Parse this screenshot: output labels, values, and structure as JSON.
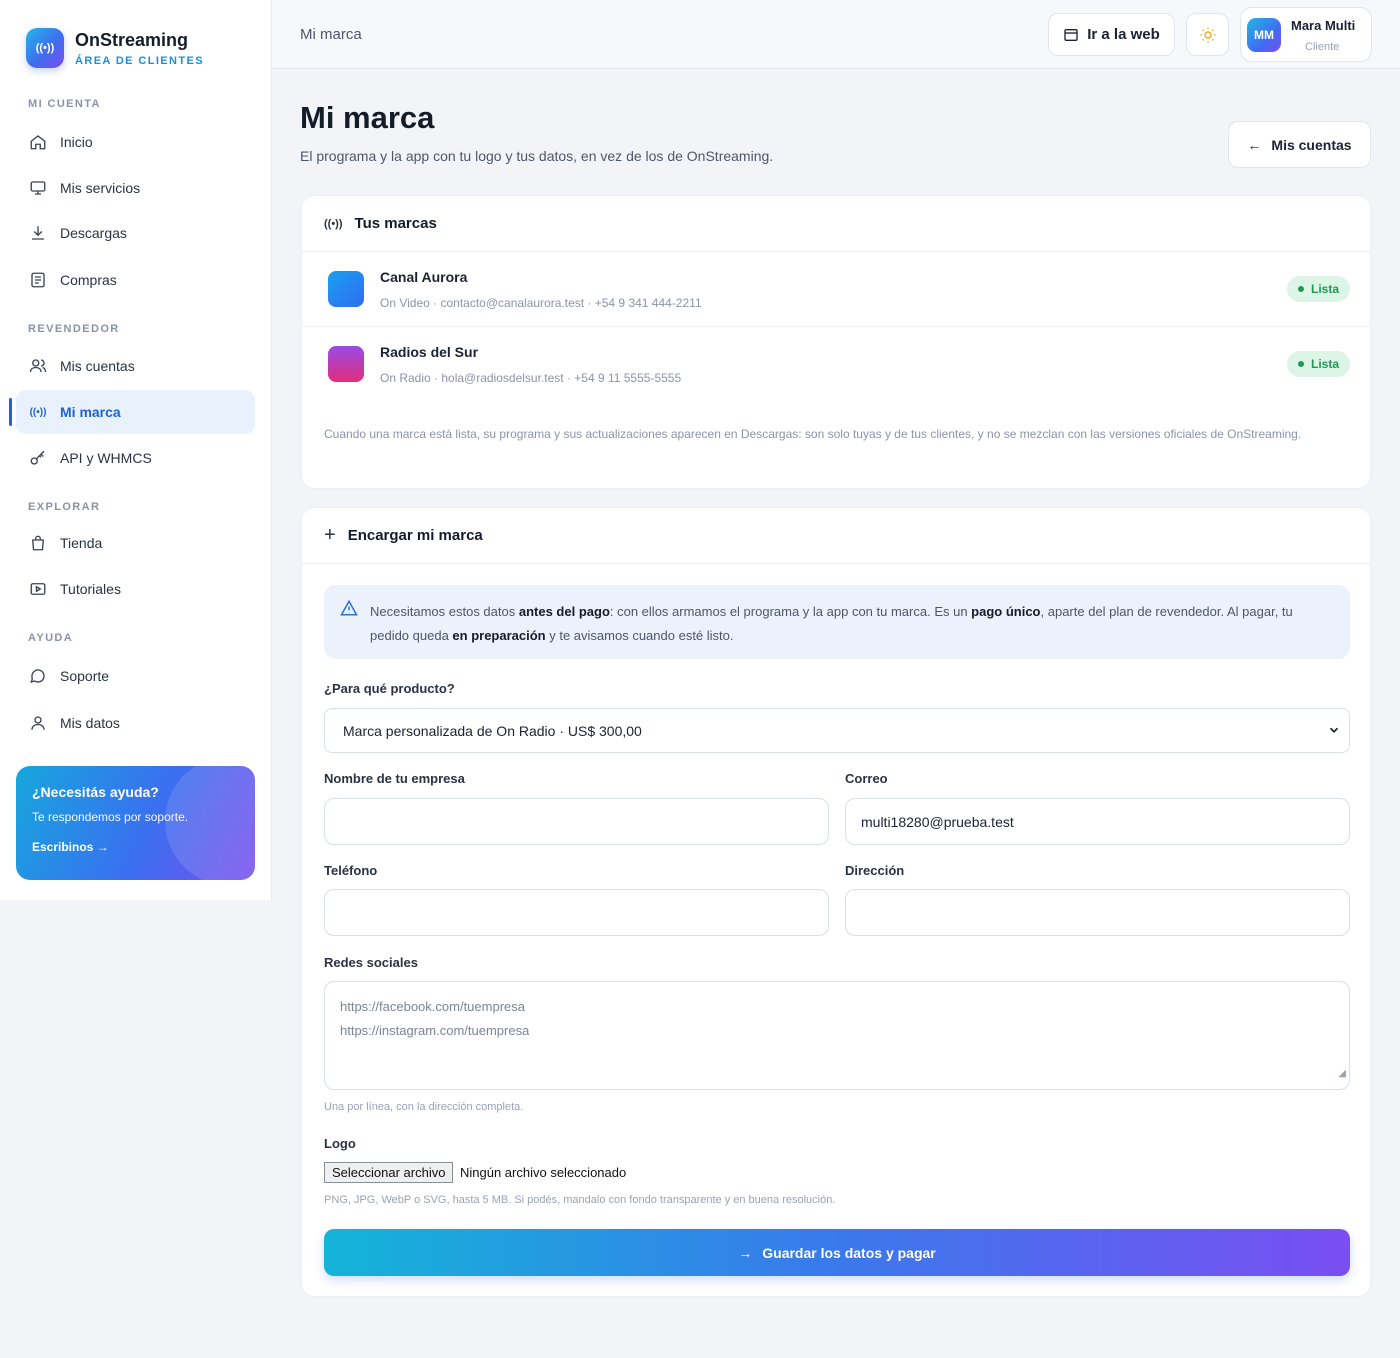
{
  "brand": {
    "name": "OnStreaming",
    "subtitle": "ÁREA DE CLIENTES",
    "logo_icon": "broadcast-icon"
  },
  "sidebar": {
    "sections": [
      {
        "title": "MI CUENTA"
      },
      {
        "title": "REVENDEDOR"
      },
      {
        "title": "EXPLORAR"
      },
      {
        "title": "AYUDA"
      }
    ],
    "items": [
      {
        "label": "Inicio",
        "icon": "home-icon"
      },
      {
        "label": "Mis servicios",
        "icon": "monitor-icon"
      },
      {
        "label": "Descargas",
        "icon": "download-icon"
      },
      {
        "label": "Compras",
        "icon": "receipt-icon"
      },
      {
        "label": "Mis cuentas",
        "icon": "users-icon"
      },
      {
        "label": "Mi marca",
        "icon": "broadcast-icon",
        "active": true
      },
      {
        "label": "API y WHMCS",
        "icon": "key-icon"
      },
      {
        "label": "Tienda",
        "icon": "shopping-bag-icon"
      },
      {
        "label": "Tutoriales",
        "icon": "play-icon"
      },
      {
        "label": "Soporte",
        "icon": "chat-icon"
      },
      {
        "label": "Mis datos",
        "icon": "user-icon"
      }
    ],
    "help": {
      "title": "¿Necesitás ayuda?",
      "text": "Te respondemos por soporte.",
      "link": "Escribinos →"
    }
  },
  "header": {
    "breadcrumb": "Mi marca",
    "web_button": "Ir a la web",
    "user": {
      "initials": "MM",
      "name": "Mara Multi",
      "role": "Cliente"
    }
  },
  "page": {
    "title": "Mi marca",
    "description": "El programa y la app con tu logo y tus datos, en vez de los de OnStreaming.",
    "back_button": "Mis cuentas"
  },
  "brands_card": {
    "title": "Tus marcas",
    "items": [
      {
        "name": "Canal Aurora",
        "meta": "On Video · contacto@canalaurora.test · +54 9 341 444-2211",
        "status": "Lista",
        "color": "#1f7ff0"
      },
      {
        "name": "Radios del Sur",
        "meta": "On Radio · hola@radiosdelsur.test · +54 9 11 5555-5555",
        "status": "Lista",
        "color": "#c23fd8"
      }
    ],
    "note": "Cuando una marca está lista, su programa y sus actualizaciones aparecen en Descargas: son solo tuyas y de tus clientes, y no se mezclan con las versiones oficiales de OnStreaming."
  },
  "order_card": {
    "title": "Encargar mi marca",
    "info": {
      "p1": "Necesitamos estos datos ",
      "b1": "antes del pago",
      "p2": ": con ellos armamos el programa y la app con tu marca. Es un ",
      "b2": "pago único",
      "p3": ", aparte del plan de revendedor. Al pagar, tu pedido queda ",
      "b3": "en preparación",
      "p4": " y te avisamos cuando esté listo."
    },
    "product_label": "¿Para qué producto?",
    "product_value": "Marca personalizada de On Radio · US$ 300,00",
    "company_label": "Nombre de tu empresa",
    "company_value": "",
    "email_label": "Correo",
    "email_value": "multi18280@prueba.test",
    "phone_label": "Teléfono",
    "phone_value": "",
    "address_label": "Dirección",
    "address_value": "",
    "social_label": "Redes sociales",
    "social_placeholder_1": "https://facebook.com/tuempresa",
    "social_placeholder_2": "https://instagram.com/tuempresa",
    "social_hint": "Una por línea, con la dirección completa.",
    "logo_label": "Logo",
    "file_button": "Seleccionar archivo",
    "file_status": "Ningún archivo seleccionado",
    "logo_hint": "PNG, JPG, WebP o SVG, hasta 5 MB. Si podés, mandalo con fondo transparente y en buena resolución.",
    "submit": "Guardar los datos y pagar"
  }
}
